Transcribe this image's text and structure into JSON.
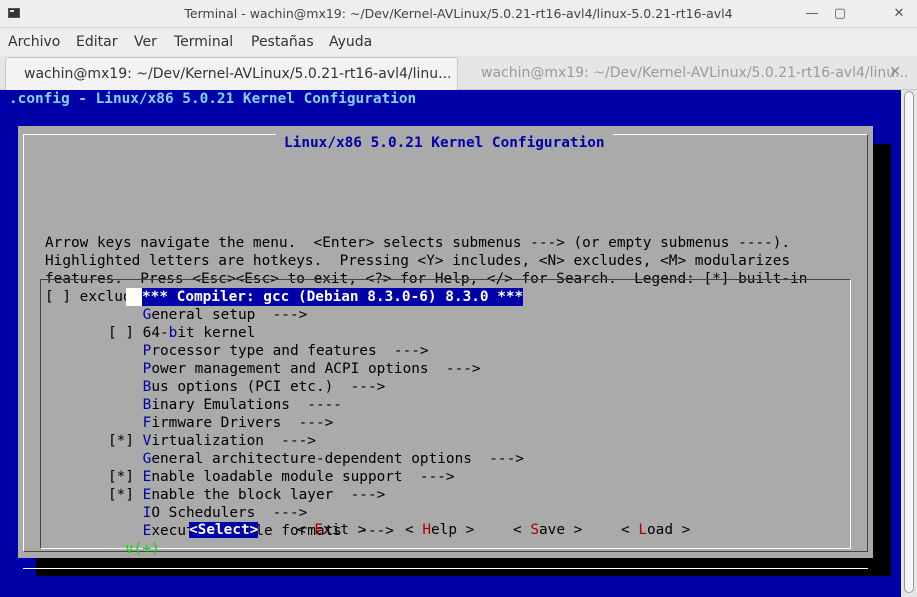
{
  "window": {
    "title": "Terminal - wachin@mx19: ~/Dev/Kernel-AVLinux/5.0.21-rt16-avl4/linux-5.0.21-rt16-avl4",
    "minimize": "—",
    "maximize": "▢",
    "close": "✕"
  },
  "menu": [
    "Archivo",
    "Editar",
    "Ver",
    "Terminal",
    "Pestañas",
    "Ayuda"
  ],
  "tabs": [
    {
      "label": "wachin@mx19: ~/Dev/Kernel-AVLinux/5.0.21-rt16-avl4/linu...",
      "close": "✕"
    },
    {
      "label": "wachin@mx19: ~/Dev/Kernel-AVLinux/5.0.21-rt16-avl4/linu...",
      "close": "✕"
    }
  ],
  "terminal": {
    "header": ".config - Linux/x86 5.0.21 Kernel Configuration",
    "dialog_title": "Linux/x86 5.0.21 Kernel Configuration",
    "help_lines": [
      "Arrow keys navigate the menu.  <Enter> selects submenus ---> (or empty submenus ----).",
      "Highlighted letters are hotkeys.  Pressing <Y> includes, <N> excludes, <M> modularizes",
      "features.  Press <Esc><Esc> to exit, <?> for Help, </> for Search.  Legend: [*] built-in",
      "[ ] excluded  <M> module  < > module capable"
    ],
    "selected_item": "*** Compiler: gcc (Debian 8.3.0-6) 8.3.0 ***",
    "items": [
      {
        "prefix": "   ",
        "pre": "",
        "hotkey": "G",
        "rest": "eneral setup  --->"
      },
      {
        "prefix": "[ ]",
        "pre": "64-",
        "hotkey": "b",
        "rest": "it kernel"
      },
      {
        "prefix": "   ",
        "pre": "",
        "hotkey": "P",
        "rest": "rocessor type and features  --->"
      },
      {
        "prefix": "   ",
        "pre": "",
        "hotkey": "P",
        "rest": "ower management and ACPI options  --->"
      },
      {
        "prefix": "   ",
        "pre": "",
        "hotkey": "B",
        "rest": "us options (PCI etc.)  --->"
      },
      {
        "prefix": "   ",
        "pre": "",
        "hotkey": "B",
        "rest": "inary Emulations  ----"
      },
      {
        "prefix": "   ",
        "pre": "",
        "hotkey": "F",
        "rest": "irmware Drivers  --->"
      },
      {
        "prefix": "[*]",
        "pre": "",
        "hotkey": "V",
        "rest": "irtualization  --->"
      },
      {
        "prefix": "   ",
        "pre": "",
        "hotkey": "G",
        "rest": "eneral architecture-dependent options  --->"
      },
      {
        "prefix": "[*]",
        "pre": "",
        "hotkey": "E",
        "rest": "nable loadable module support  --->"
      },
      {
        "prefix": "[*]",
        "pre": "",
        "hotkey": "E",
        "rest": "nable the block layer  --->"
      },
      {
        "prefix": "   ",
        "pre": "",
        "hotkey": "I",
        "rest": "O Schedulers  --->"
      },
      {
        "prefix": "   ",
        "pre": "",
        "hotkey": "E",
        "rest": "xecutable file formats  --->"
      }
    ],
    "more_indicator": "v(+)",
    "buttons": [
      {
        "lt": "<",
        "hotkey": "S",
        "rest": "elect",
        "gt": ">"
      },
      {
        "lt": "< ",
        "hotkey": "E",
        "rest": "xit",
        "gt": " >"
      },
      {
        "lt": "< ",
        "hotkey": "H",
        "rest": "elp",
        "gt": " >"
      },
      {
        "lt": "< ",
        "hotkey": "S",
        "rest": "ave",
        "gt": " >"
      },
      {
        "lt": "< ",
        "hotkey": "L",
        "rest": "oad",
        "gt": " >"
      }
    ]
  }
}
